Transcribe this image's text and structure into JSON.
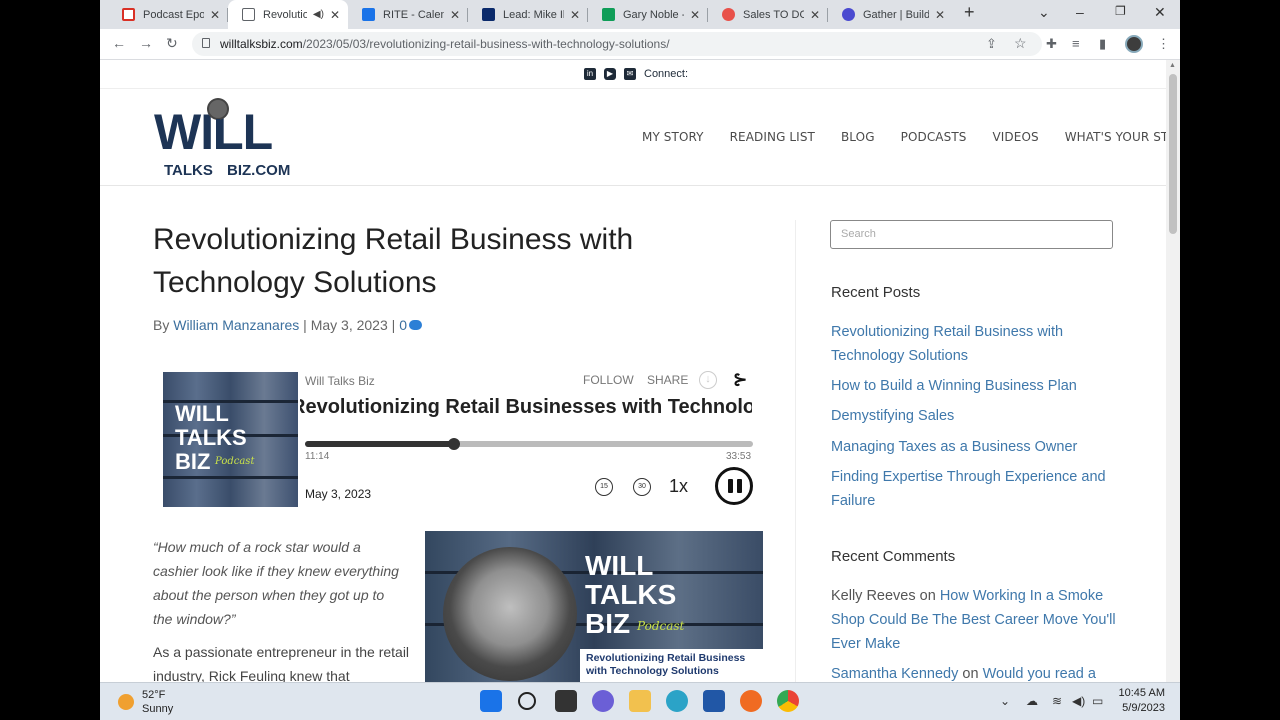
{
  "browser": {
    "tabs": [
      {
        "label": "Podcast Eposid",
        "favicon_color": "#d93025",
        "active": false
      },
      {
        "label": "Revolution",
        "favicon_color": "#5f6368",
        "active": true
      },
      {
        "label": "RITE - Calenda",
        "favicon_color": "#1a73e8",
        "active": false
      },
      {
        "label": "Lead: Mike Ibs",
        "favicon_color": "#0b2a6b",
        "active": false
      },
      {
        "label": "Gary Noble - C",
        "favicon_color": "#0f9d58",
        "active": false
      },
      {
        "label": "Sales TO DO -",
        "favicon_color": "#e8514a",
        "active": false
      },
      {
        "label": "Gather | Buildi",
        "favicon_color": "#4a4ad0",
        "active": false
      }
    ],
    "url_host": "willtalksbiz.com",
    "url_path": "/2023/05/03/revolutionizing-retail-business-with-technology-solutions/"
  },
  "site": {
    "connect_label": "Connect:",
    "logo": {
      "line1": "WILL",
      "line2": "TALKS",
      "line3": "BIZ.COM"
    },
    "nav": [
      "MY STORY",
      "READING LIST",
      "BLOG",
      "PODCASTS",
      "VIDEOS",
      "WHAT'S YOUR STORY?"
    ]
  },
  "post": {
    "title": "Revolutionizing Retail Business with Technology Solutions",
    "by": "By",
    "author": "William Manzanares",
    "sep": "|",
    "date": "May 3, 2023",
    "comments": "0",
    "quote": "“How much of a rock star would a cashier look like if they knew everything about the person when they got up to the window?”",
    "body": "As a passionate entrepreneur in the retail industry, Rick Feuling knew that"
  },
  "player": {
    "cover_lines": [
      "WILL",
      "TALKS",
      "BIZ"
    ],
    "cover_script": "Podcast",
    "show": "Will Talks Biz",
    "follow": "FOLLOW",
    "share": "SHARE",
    "episode": "Revolutionizing Retail Businesses with Technology Solutions",
    "elapsed": "11:14",
    "duration": "33:53",
    "progress": 0.332,
    "date": "May 3, 2023",
    "rewind_label": "15",
    "forward_label": "30",
    "speed": "1x"
  },
  "feature": {
    "lines": [
      "WILL",
      "TALKS",
      "BIZ"
    ],
    "script": "Podcast",
    "subtitle": "Revolutionizing Retail Business with Technology Solutions"
  },
  "sidebar": {
    "search_placeholder": "Search",
    "recent_posts_heading": "Recent Posts",
    "recent_posts": [
      "Revolutionizing Retail Business with Technology Solutions",
      "How to Build a Winning Business Plan",
      "Demystifying Sales",
      "Managing Taxes as a Business Owner",
      "Finding Expertise Through Experience and Failure"
    ],
    "recent_comments_heading": "Recent Comments",
    "comments": [
      {
        "author": "Kelly Reeves",
        "on": "on",
        "post": "How Working In a Smoke Shop Could Be The Best Career Move You'll Ever Make"
      },
      {
        "author": "Samantha Kennedy",
        "on": "on",
        "post": "Would you read a"
      }
    ]
  },
  "taskbar": {
    "temp": "52°F",
    "condition": "Sunny",
    "time": "10:45 AM",
    "date": "5/9/2023"
  }
}
